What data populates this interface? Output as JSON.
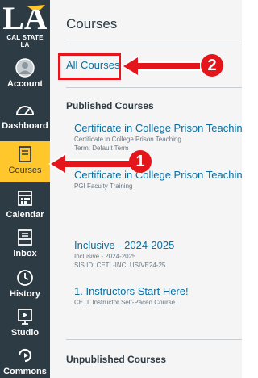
{
  "brand": {
    "logo_text": "LA",
    "name": "CAL STATE LA"
  },
  "nav": {
    "items": [
      {
        "label": "Account",
        "icon": "account-avatar-icon"
      },
      {
        "label": "Dashboard",
        "icon": "dashboard-gauge-icon"
      },
      {
        "label": "Courses",
        "icon": "courses-book-icon",
        "active": true
      },
      {
        "label": "Calendar",
        "icon": "calendar-icon"
      },
      {
        "label": "Inbox",
        "icon": "inbox-icon"
      },
      {
        "label": "History",
        "icon": "history-clock-icon"
      },
      {
        "label": "Studio",
        "icon": "studio-icon"
      },
      {
        "label": "Commons",
        "icon": "commons-share-icon"
      }
    ]
  },
  "tray": {
    "title": "Courses",
    "all_courses_link": "All Courses",
    "published_heading": "Published Courses",
    "unpublished_heading": "Unpublished Courses",
    "courses": [
      {
        "title": "Certificate in College Prison Teaching",
        "meta1": "Certificate in College Prison Teaching",
        "meta2": "Term: Default Term"
      },
      {
        "title": "Certificate in College Prison Teaching",
        "meta1": "PGI Faculty Training",
        "meta2": ""
      },
      {
        "title": "Inclusive - 2024-2025",
        "meta1": "Inclusive - 2024-2025",
        "meta2": "SIS ID: CETL-INCLUSIVE24-25"
      },
      {
        "title": "1. Instructors Start Here!",
        "meta1": "CETL Instructor Self-Paced Course",
        "meta2": ""
      }
    ]
  },
  "annotations": {
    "step1": "1",
    "step2": "2"
  },
  "colors": {
    "nav_bg": "#2d3b45",
    "active": "#ffc72c",
    "link": "#0770a3",
    "annotation": "#e4161b"
  }
}
